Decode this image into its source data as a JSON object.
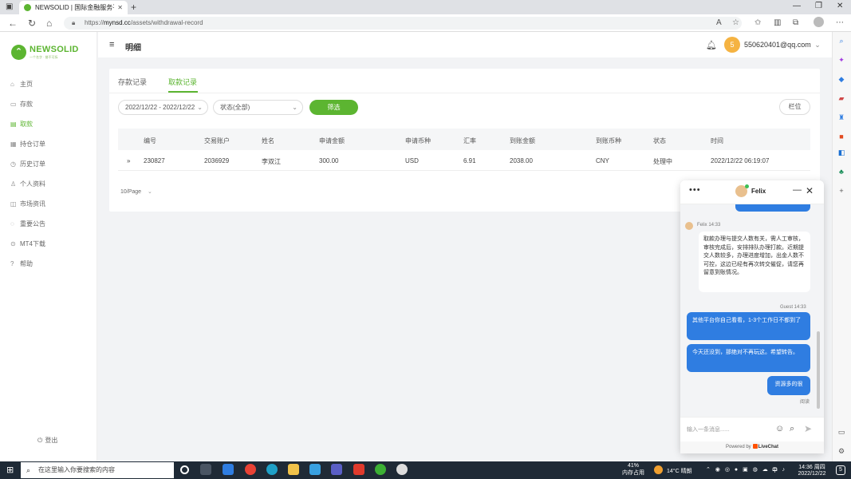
{
  "browser": {
    "tab_title": "NEWSOLID | 国际金融服务平台",
    "url_scheme": "https://",
    "url_host": "mynsd.cc",
    "url_path": "/assets/withdrawal-record"
  },
  "brand": {
    "name": "NEWSOLID",
    "slogan": "一个名字 · 誉不可拆"
  },
  "sidebar": {
    "items": [
      {
        "label": "主页",
        "icon": "home-icon"
      },
      {
        "label": "存款",
        "icon": "deposit-icon"
      },
      {
        "label": "取款",
        "icon": "withdraw-icon"
      },
      {
        "label": "持仓订单",
        "icon": "position-icon"
      },
      {
        "label": "历史订单",
        "icon": "history-icon"
      },
      {
        "label": "个人资料",
        "icon": "profile-icon"
      },
      {
        "label": "市场资讯",
        "icon": "news-icon"
      },
      {
        "label": "重要公告",
        "icon": "announcement-icon"
      },
      {
        "label": "MT4下载",
        "icon": "download-icon"
      },
      {
        "label": "帮助",
        "icon": "help-icon"
      }
    ],
    "logout_label": "登出"
  },
  "header": {
    "title": "明细",
    "avatar_letter": "5",
    "user_email": "550620401@qq.com"
  },
  "record": {
    "tabs": [
      "存款记录",
      "取款记录"
    ],
    "date_range": "2022/12/22 - 2022/12/22",
    "status_select": "状态(全部)",
    "filter_button": "筛选",
    "columns_button": "栏位",
    "columns": [
      "编号",
      "交易账户",
      "姓名",
      "申请金额",
      "申请币种",
      "汇率",
      "到账金额",
      "到账币种",
      "状态",
      "时间"
    ],
    "rows": [
      [
        "230827",
        "2036929",
        "李双江",
        "300.00",
        "USD",
        "6.91",
        "2038.00",
        "CNY",
        "处理中",
        "2022/12/22 06:19:07"
      ]
    ],
    "page_size": "10/Page"
  },
  "chat": {
    "agent_name": "Felix",
    "agent_meta": "Felix 14:33",
    "agent_message": "取款办理与提交人数有关，需人工审核，审核完成后，安排排队办理打款。近期提交人数较多，办理进度增加，出金人数不可控，这边已经有再次转交催促，请您再留意到账情况。",
    "guest_meta": "Guest 14:33",
    "guest_messages": [
      "其他平台你自己看看，1-3个工作日不都到了",
      "今天还没到，那绝对不再玩这。希望转告。",
      "资源多的很"
    ],
    "read_label": "阅读",
    "input_placeholder": "输入一条消息......",
    "powered_prefix": "Powered by",
    "powered_brand": "LiveChat"
  },
  "taskbar": {
    "search_placeholder": "在这里输入你要搜索的内容",
    "memory_percent": "41%",
    "memory_label": "内存占用",
    "weather": "14°C 晴朗",
    "ime": "中",
    "time": "14:36 周四",
    "date": "2022/12/22",
    "notification_count": "5"
  },
  "colors": {
    "brand_green": "#5cb531",
    "chat_blue": "#2f7de1",
    "taskbar": "#1f2a36"
  }
}
